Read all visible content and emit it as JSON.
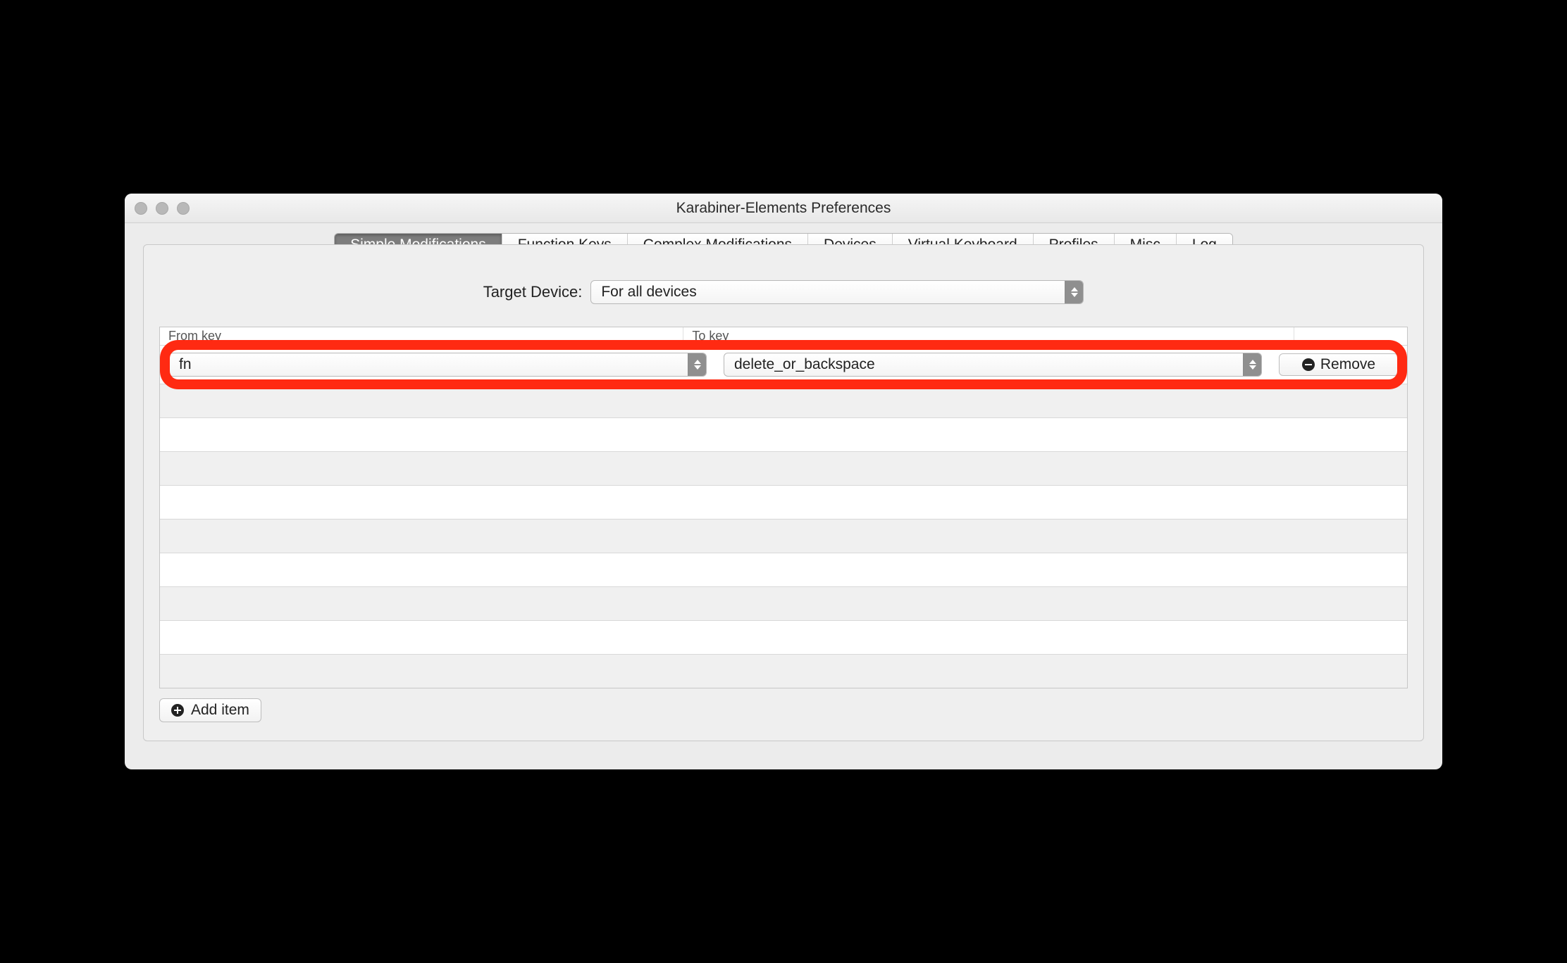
{
  "window": {
    "title": "Karabiner-Elements Preferences"
  },
  "tabs": {
    "items": [
      "Simple Modifications",
      "Function Keys",
      "Complex Modifications",
      "Devices",
      "Virtual Keyboard",
      "Profiles",
      "Misc",
      "Log"
    ],
    "active_index": 0
  },
  "target": {
    "label": "Target Device:",
    "value": "For all devices"
  },
  "columns": {
    "from": "From key",
    "to": "To key"
  },
  "rows": [
    {
      "from": "fn",
      "to": "delete_or_backspace",
      "remove_label": "Remove"
    }
  ],
  "add_item_label": "Add item",
  "empty_row_count": 9
}
